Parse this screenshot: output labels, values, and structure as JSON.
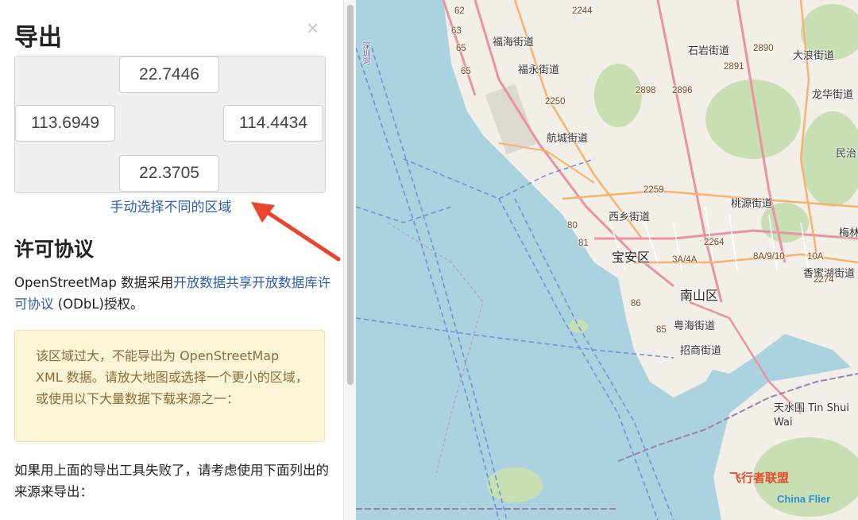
{
  "export_panel": {
    "title": "导出",
    "close_label": "×",
    "bbox": {
      "top": "22.7446",
      "left": "113.6949",
      "right": "114.4434",
      "bottom": "22.3705"
    },
    "manual_select_link": "手动选择不同的区域"
  },
  "license": {
    "title": "许可协议",
    "text_before": "OpenStreetMap 数据采用",
    "link_text": "开放数据共享开放数据库许可协议",
    "text_after": " (ODbL)授权。"
  },
  "warning": {
    "text": "该区域过大，不能导出为 OpenStreetMap XML 数据。请放大地图或选择一个更小的区域，或使用以下大量数据下载来源之一："
  },
  "fallback": {
    "text": "如果用上面的导出工具失败了，请考虑使用下面列出的来源来导出："
  },
  "map": {
    "districts": [
      "福海街道",
      "福永街道",
      "航城街道",
      "西乡街道",
      "宝安区",
      "南山区",
      "粤海街道",
      "招商街道",
      "石岩街道",
      "大浪街道",
      "龙华街道",
      "民治",
      "桃源街道",
      "梅林",
      "香蜜湖街道",
      "天水围 Tin Shui Wai"
    ],
    "road_refs": [
      "2244",
      "2890",
      "2891",
      "2250",
      "2898",
      "2896",
      "2259",
      "2264",
      "2274",
      "3A/4A",
      "8A/9/10",
      "10A",
      "80",
      "81",
      "86",
      "85",
      "65",
      "62",
      "63",
      "65"
    ],
    "river_label": "深圳河"
  },
  "watermark": {
    "line1": "飞行者联盟",
    "line2": "China Flier"
  },
  "colors": {
    "link": "#2a5db0",
    "warning_bg": "#fcf4d6",
    "warning_text": "#8a6d3b",
    "sea": "#aad3df",
    "land": "#f2efe9",
    "arrow": "#e8452c"
  }
}
